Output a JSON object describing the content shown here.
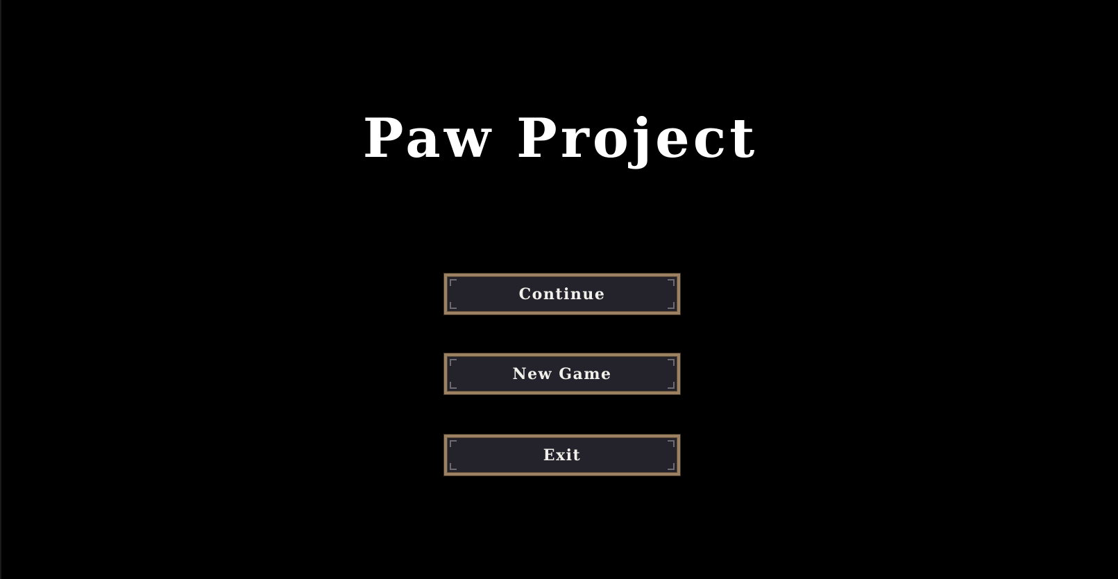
{
  "game_title": "Paw Project",
  "main_menu": {
    "continue_label": "Continue",
    "new_game_label": "New Game",
    "exit_label": "Exit"
  },
  "colors": {
    "background": "#000000",
    "button_fill": "#24232c",
    "button_border": "#9c8262",
    "text": "#ffffff"
  }
}
